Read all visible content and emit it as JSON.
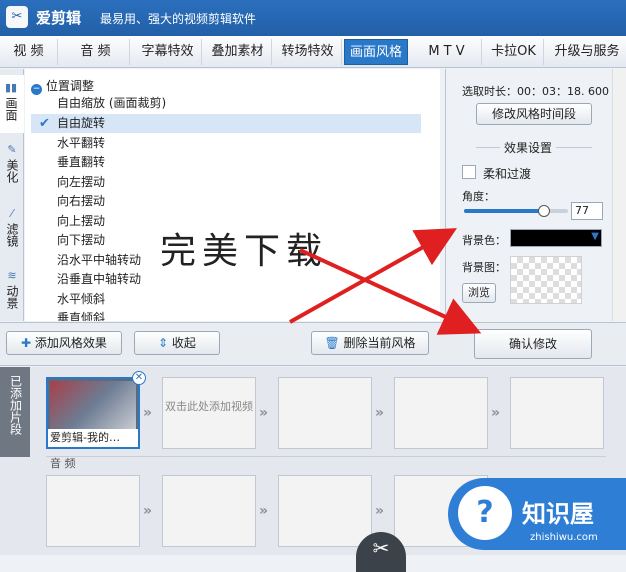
{
  "app": {
    "name": "爱剪辑",
    "slogan": "最易用、强大的视频剪辑软件",
    "logo_glyph": "✂"
  },
  "tabs": [
    "视 频",
    "音 频",
    "字幕特效",
    "叠加素材",
    "转场特效",
    "画面风格",
    "M T V",
    "卡拉OK",
    "升级与服务"
  ],
  "active_tab": "画面风格",
  "side_tabs": [
    {
      "label": "画面",
      "icon": "film-icon",
      "active": true
    },
    {
      "label": "美化",
      "icon": "brush-icon",
      "active": false
    },
    {
      "label": "滤镜",
      "icon": "wand-icon",
      "active": false
    },
    {
      "label": "动景",
      "icon": "wave-icon",
      "active": false
    }
  ],
  "style_list": {
    "group_label": "位置调整",
    "items": [
      "自由缩放 (画面裁剪)",
      "自由旋转",
      "水平翻转",
      "垂直翻转",
      "向左摆动",
      "向右摆动",
      "向上摆动",
      "向下摆动",
      "沿水平中轴转动",
      "沿垂直中轴转动",
      "水平倾斜",
      "垂直倾斜"
    ],
    "selected": "自由旋转"
  },
  "settings": {
    "duration_label": "选取时长：",
    "duration_value": "00：03：18. 600",
    "modify_time_button": "修改风格时间段",
    "section_title": "效果设置",
    "smooth_label": "柔和过渡",
    "smooth_checked": false,
    "angle_label": "角度：",
    "angle_value": "77",
    "angle_fraction": 0.77,
    "bg_color_label": "背景色：",
    "bg_color": "#000000",
    "bg_image_label": "背景图：",
    "browse_button": "浏览",
    "confirm_button": "确认修改"
  },
  "bottom_buttons": {
    "add": "添加风格效果",
    "collapse": "收起",
    "delete": "删除当前风格"
  },
  "timeline": {
    "side_label": "已添加片段",
    "clip1_name": "爱剪辑-我的…",
    "placeholder_text": "双击此处添加视频",
    "audio_label": "音 频"
  },
  "watermark": "完美下载",
  "brand": {
    "name": "知识屋",
    "url": "zhishiwu.com",
    "icon_glyph": "?"
  },
  "colors": {
    "accent": "#2a78c8",
    "titlebar": "#2260a8",
    "arrow_red": "#e02020"
  }
}
